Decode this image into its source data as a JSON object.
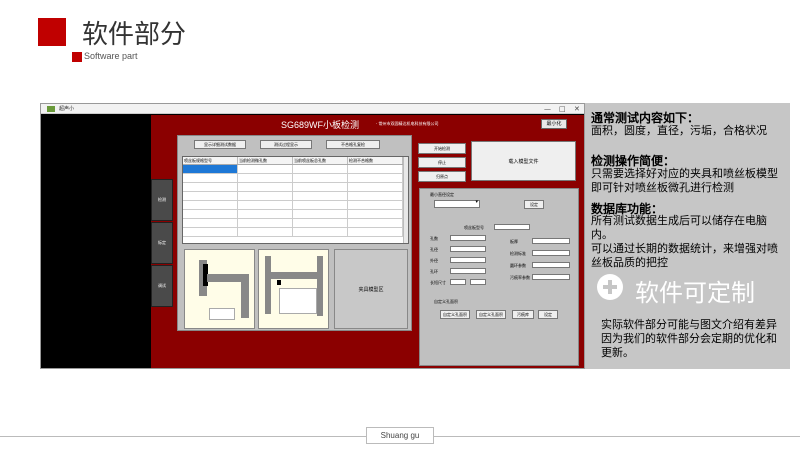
{
  "slide": {
    "title": "软件部分",
    "subtitle": "Software part",
    "footer": "Shuang gu"
  },
  "window": {
    "title": "超声小",
    "controls": [
      "—",
      "□",
      "✕"
    ]
  },
  "app": {
    "title": "SG689WF小板检测",
    "company": "· 常州市双固精达机电科技有限公司",
    "minimize": "最小化",
    "side_tabs": [
      "检测",
      "标定",
      "调试"
    ],
    "top_buttons": [
      "显示详细测试数据",
      "测试过程显示",
      "不合格孔复检"
    ],
    "table": {
      "columns": [
        "喷丝板规格型号",
        "当前检测微孔数",
        "当前喷丝板总孔数",
        "检测不合格数"
      ]
    },
    "jig_label": "夹具模型区",
    "right_buttons": [
      "开始检测",
      "停止",
      "归原点"
    ],
    "load_button": "载入模型文件",
    "params": {
      "min_dia": "最小直径设定",
      "set_btn": "设定",
      "spinneret_model": "喷丝板型号",
      "left_labels": [
        "孔数",
        "孔径",
        "外径",
        "孔环",
        "长短尺寸"
      ],
      "right_labels": [
        "板厚",
        "检测标准",
        "圆环参数",
        "污痕率参数"
      ],
      "custom_title": "自定义孔面积",
      "custom_buttons": [
        "自定义孔面积",
        "自定义孔面积",
        "污痕库",
        "设定"
      ]
    }
  },
  "info": {
    "h1": "通常测试内容如下：",
    "t1": "面积，圆度，直径，污垢，合格状况",
    "h2": "检测操作简便：",
    "t2": "只需要选择好对应的夹具和喷丝板模型即可针对喷丝板微孔进行检测",
    "h3": "数据库功能：",
    "t3": "所有测试数据生成后可以储存在电脑内。",
    "t4": "可以通过长期的数据统计，来增强对喷丝板品质的把控",
    "custom": "软件可定制",
    "note": "实际软件部分可能与图文介绍有差异因为我们的软件部分会定期的优化和更新。"
  }
}
